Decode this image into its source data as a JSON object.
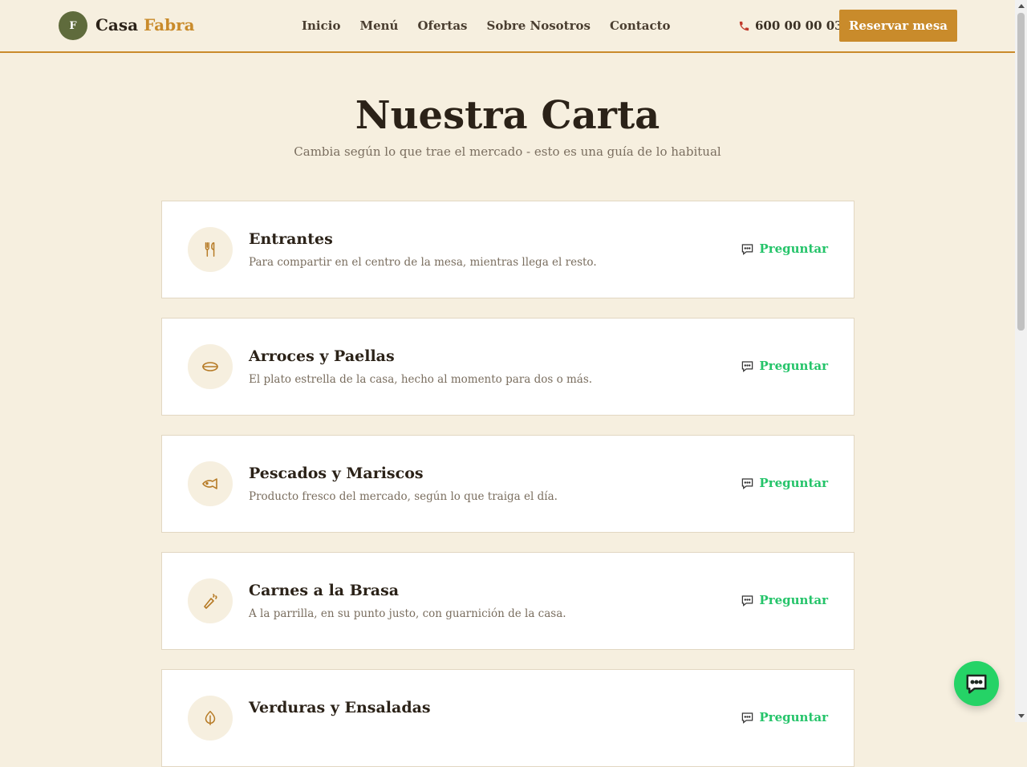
{
  "header": {
    "logo_letter": "F",
    "brand_part1": "Casa",
    "brand_part2": "Fabra",
    "nav": [
      "Inicio",
      "Menú",
      "Ofertas",
      "Sobre Nosotros",
      "Contacto"
    ],
    "phone": "600 00 00 03",
    "reserve_label": "Reservar mesa"
  },
  "hero": {
    "title": "Nuestra Carta",
    "subtitle": "Cambia según lo que trae el mercado - esto es una guía de lo habitual"
  },
  "categories": [
    {
      "name": "Entrantes",
      "description": "Para compartir en el centro de la mesa, mientras llega el resto.",
      "icon": "utensils-icon",
      "action": "Preguntar"
    },
    {
      "name": "Arroces y Paellas",
      "description": "El plato estrella de la casa, hecho al momento para dos o más.",
      "icon": "paella-pan-icon",
      "action": "Preguntar"
    },
    {
      "name": "Pescados y Mariscos",
      "description": "Producto fresco del mercado, según lo que traiga el día.",
      "icon": "fish-icon",
      "action": "Preguntar"
    },
    {
      "name": "Carnes a la Brasa",
      "description": "A la parrilla, en su punto justo, con guarnición de la casa.",
      "icon": "grill-icon",
      "action": "Preguntar"
    },
    {
      "name": "Verduras y Ensaladas",
      "description": "",
      "icon": "leaf-icon",
      "action": "Preguntar"
    }
  ],
  "colors": {
    "background": "#f6efdf",
    "accent": "#c98b2b",
    "logo_badge": "#5f6b3c",
    "action_green": "#25c46a",
    "chat_button": "#25d366"
  }
}
